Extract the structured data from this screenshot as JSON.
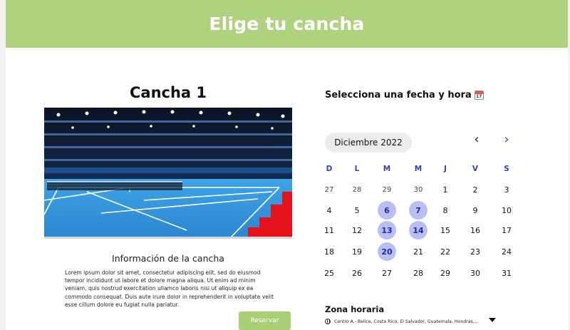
{
  "header": {
    "title": "Elige tu cancha"
  },
  "court": {
    "title": "Cancha 1",
    "image_icon": "tennis-court-photo",
    "info_title": "Información de la cancha",
    "info_text": "Lorem ipsum dolor sit amet, consectetur adipiscing elit, sed do eiusmod tempor incididunt ut labore et dolore magna aliqua. Ut enim ad minim veniam, quis nostrud exercitation ullamco laboris nisi ut aliquip ex ea commodo consequat. Duis aute irure dolor in reprehenderit in voluptate velit esse cillum dolore eu fugiat nulla pariatur.",
    "reserve_label": "Reservar"
  },
  "booking": {
    "title": "Selecciona una fecha y hora",
    "title_icon": "calendar-emoji-icon",
    "month_label": "Diciembre 2022",
    "prev_icon": "chevron-left-icon",
    "next_icon": "chevron-right-icon",
    "weekdays": [
      "D",
      "L",
      "M",
      "M",
      "J",
      "V",
      "S"
    ],
    "weeks": [
      [
        {
          "d": "27",
          "state": "muted"
        },
        {
          "d": "28",
          "state": "muted"
        },
        {
          "d": "29",
          "state": "muted"
        },
        {
          "d": "30",
          "state": "muted"
        },
        {
          "d": "1",
          "state": "normal"
        },
        {
          "d": "2",
          "state": "normal"
        },
        {
          "d": "3",
          "state": "normal"
        }
      ],
      [
        {
          "d": "4",
          "state": "normal"
        },
        {
          "d": "5",
          "state": "normal"
        },
        {
          "d": "6",
          "state": "available"
        },
        {
          "d": "7",
          "state": "available"
        },
        {
          "d": "8",
          "state": "normal"
        },
        {
          "d": "9",
          "state": "normal"
        },
        {
          "d": "10",
          "state": "normal"
        }
      ],
      [
        {
          "d": "11",
          "state": "normal"
        },
        {
          "d": "12",
          "state": "normal"
        },
        {
          "d": "13",
          "state": "available"
        },
        {
          "d": "14",
          "state": "available"
        },
        {
          "d": "15",
          "state": "normal"
        },
        {
          "d": "16",
          "state": "normal"
        },
        {
          "d": "17",
          "state": "normal"
        }
      ],
      [
        {
          "d": "18",
          "state": "normal"
        },
        {
          "d": "19",
          "state": "normal"
        },
        {
          "d": "20",
          "state": "available"
        },
        {
          "d": "21",
          "state": "normal"
        },
        {
          "d": "22",
          "state": "normal"
        },
        {
          "d": "23",
          "state": "normal"
        },
        {
          "d": "24",
          "state": "normal"
        }
      ],
      [
        {
          "d": "25",
          "state": "normal"
        },
        {
          "d": "26",
          "state": "normal"
        },
        {
          "d": "27",
          "state": "normal"
        },
        {
          "d": "28",
          "state": "normal"
        },
        {
          "d": "29",
          "state": "normal"
        },
        {
          "d": "30",
          "state": "normal"
        },
        {
          "d": "31",
          "state": "normal"
        }
      ]
    ],
    "timezone_title": "Zona horaria",
    "timezone_value": "Centro A.- Belice, Costa Rico, El Salvador, Guatemala, Hondras,...",
    "timezone_icon": "globe-icon"
  },
  "colors": {
    "header_bg": "#afd27e",
    "accent": "#3d3fd1",
    "available_bg": "#b9bff2",
    "button_bg": "#a9cf74"
  }
}
